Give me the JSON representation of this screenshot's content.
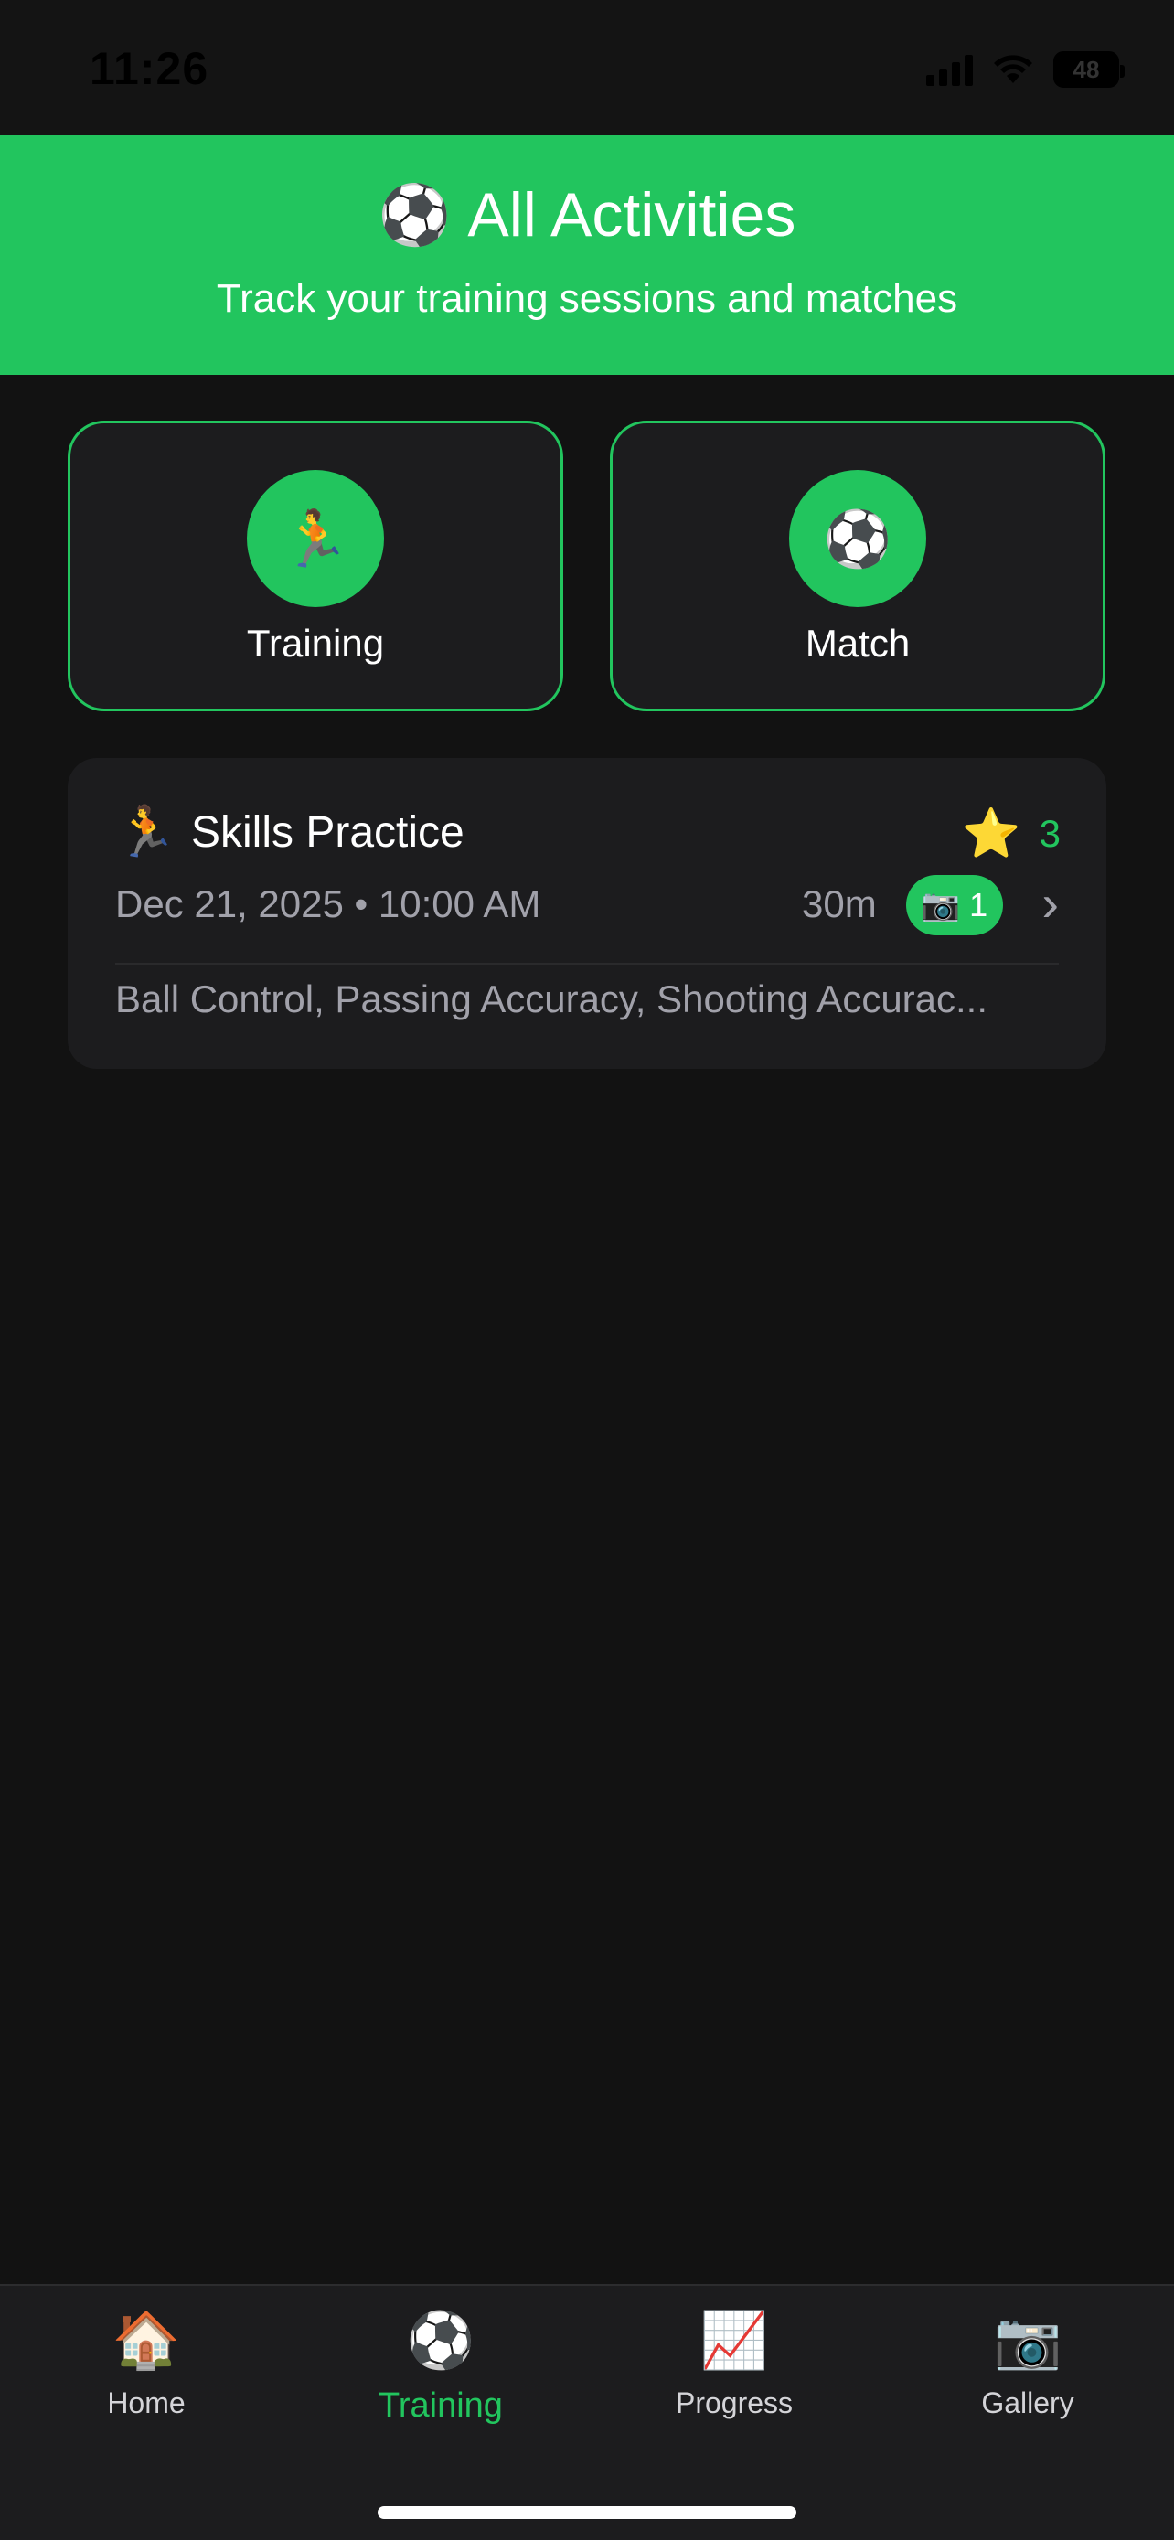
{
  "status_bar": {
    "time": "11:26",
    "battery": "48"
  },
  "header": {
    "icon": "soccer-ball-icon",
    "icon_glyph": "⚽",
    "title": "All Activities",
    "subtitle": "Track your training sessions and matches",
    "background_color": "#22c55e"
  },
  "quick_actions": [
    {
      "icon": "runner-icon",
      "glyph": "🏃",
      "label": "Training"
    },
    {
      "icon": "soccer-ball-icon",
      "glyph": "⚽",
      "label": "Match"
    }
  ],
  "activities": [
    {
      "icon": "runner-icon",
      "glyph": "🏃",
      "title": "Skills Practice",
      "rating_glyph": "⭐",
      "rating": "3",
      "date": "Dec 21, 2025",
      "separator": "•",
      "time": "10:00 AM",
      "duration": "30m",
      "photo_glyph": "📷",
      "photo_count": "1",
      "chevron": "›",
      "skills": "Ball Control, Passing Accuracy, Shooting Accurac..."
    }
  ],
  "tab_bar": {
    "active": "Training",
    "items": [
      {
        "icon": "house-icon",
        "glyph": "🏠",
        "label": "Home"
      },
      {
        "icon": "soccer-ball-icon",
        "glyph": "⚽",
        "label": "Training"
      },
      {
        "icon": "chart-increasing-icon",
        "glyph": "📈",
        "label": "Progress"
      },
      {
        "icon": "camera-icon",
        "glyph": "📷",
        "label": "Gallery"
      }
    ]
  },
  "colors": {
    "accent": "#22c55e",
    "background": "#121212",
    "card": "#1c1c1e",
    "muted_text": "#a1a1aa"
  }
}
